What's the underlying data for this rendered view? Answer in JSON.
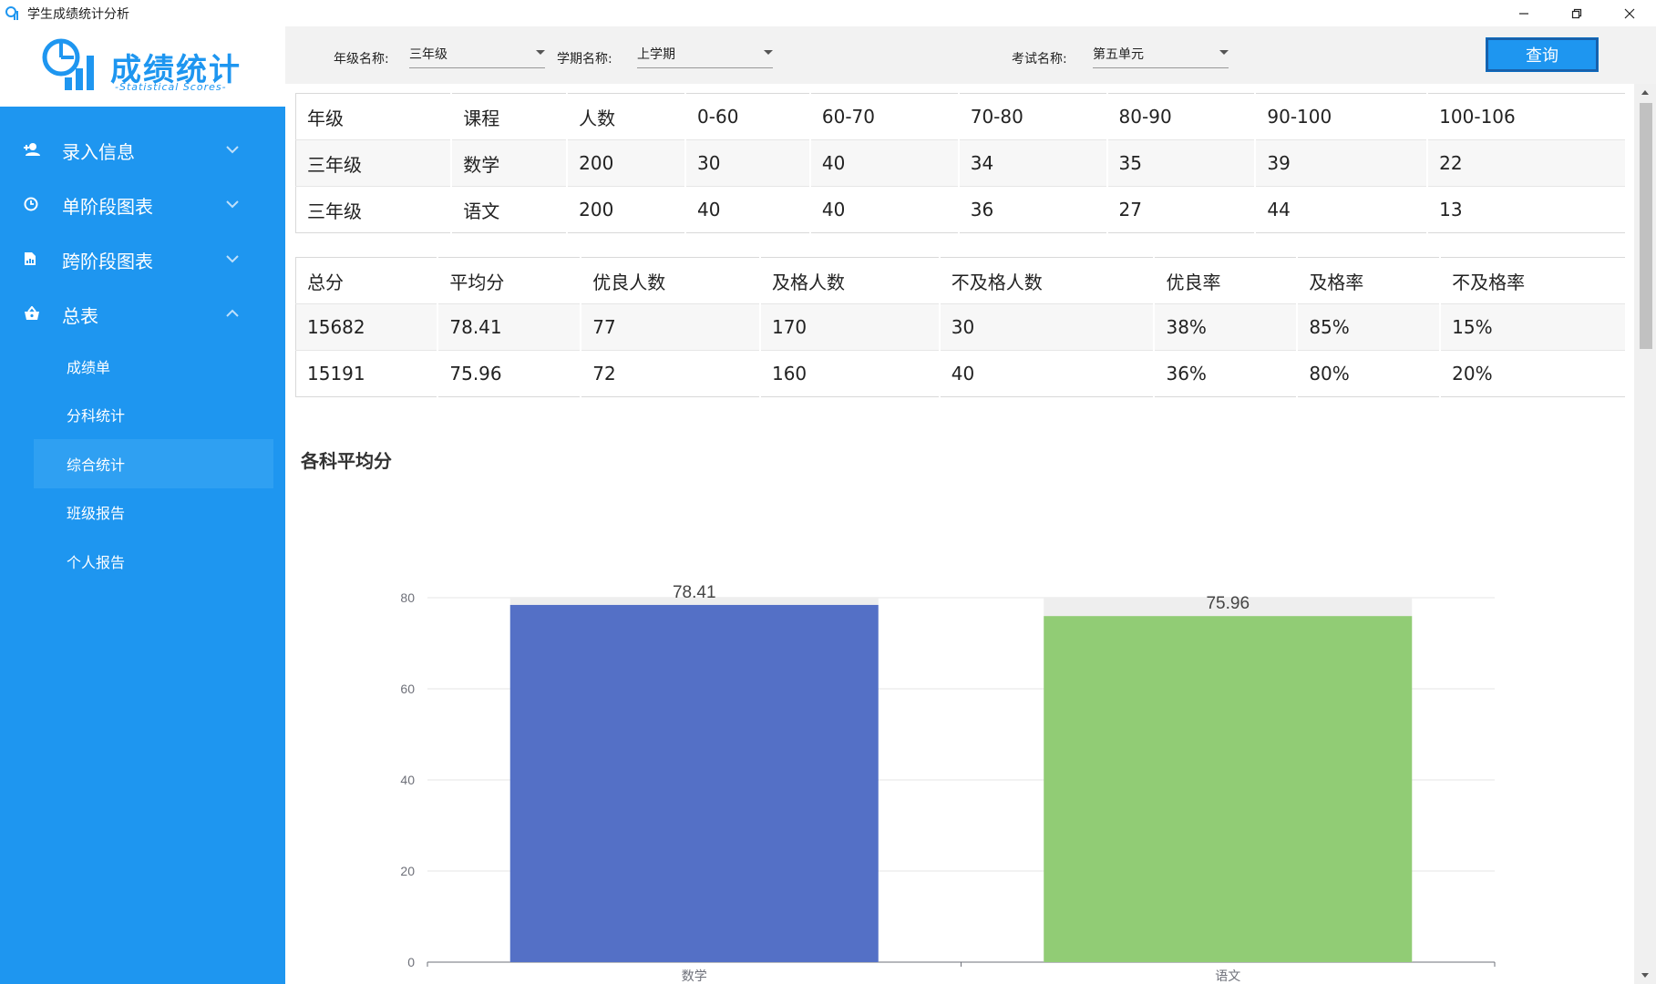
{
  "window": {
    "title": "学生成绩统计分析",
    "minimize": "—",
    "restore": "❐",
    "close": "✕"
  },
  "logo": {
    "title": "成绩统计",
    "subtitle": "-Statistical Scores-"
  },
  "sidebar": {
    "items": [
      {
        "label": "录入信息",
        "icon": "add-user-icon",
        "expanded": false
      },
      {
        "label": "单阶段图表",
        "icon": "clock-icon",
        "expanded": false
      },
      {
        "label": "跨阶段图表",
        "icon": "file-chart-icon",
        "expanded": false
      },
      {
        "label": "总表",
        "icon": "basket-icon",
        "expanded": true
      }
    ],
    "subitems": [
      {
        "label": "成绩单",
        "active": false
      },
      {
        "label": "分科统计",
        "active": false
      },
      {
        "label": "综合统计",
        "active": true
      },
      {
        "label": "班级报告",
        "active": false
      },
      {
        "label": "个人报告",
        "active": false
      }
    ]
  },
  "filters": {
    "grade_label": "年级名称:",
    "grade_value": "三年级",
    "term_label": "学期名称:",
    "term_value": "上学期",
    "exam_label": "考试名称:",
    "exam_value": "第五单元",
    "query_label": "查询"
  },
  "table1": {
    "headers": [
      "年级",
      "课程",
      "人数",
      "0-60",
      "60-70",
      "70-80",
      "80-90",
      "90-100",
      "100-106"
    ],
    "rows": [
      [
        "三年级",
        "数学",
        "200",
        "30",
        "40",
        "34",
        "35",
        "39",
        "22"
      ],
      [
        "三年级",
        "语文",
        "200",
        "40",
        "40",
        "36",
        "27",
        "44",
        "13"
      ]
    ]
  },
  "table2": {
    "headers": [
      "总分",
      "平均分",
      "优良人数",
      "及格人数",
      "不及格人数",
      "优良率",
      "及格率",
      "不及格率"
    ],
    "rows": [
      [
        "15682",
        "78.41",
        "77",
        "170",
        "30",
        "38%",
        "85%",
        "15%"
      ],
      [
        "15191",
        "75.96",
        "72",
        "160",
        "40",
        "36%",
        "80%",
        "20%"
      ]
    ]
  },
  "chart_title": "各科平均分",
  "chart_data": {
    "type": "bar",
    "title": "各科平均分",
    "categories": [
      "数学",
      "语文"
    ],
    "values": [
      78.41,
      75.96
    ],
    "value_labels": [
      "78.41",
      "75.96"
    ],
    "colors": [
      "#5470c6",
      "#91cc75"
    ],
    "background_bar_color": "#eeeeee",
    "ylim": [
      0,
      80
    ],
    "yticks": [
      "0",
      "20",
      "40",
      "60",
      "80"
    ],
    "grid": true,
    "xlabel": "",
    "ylabel": ""
  }
}
